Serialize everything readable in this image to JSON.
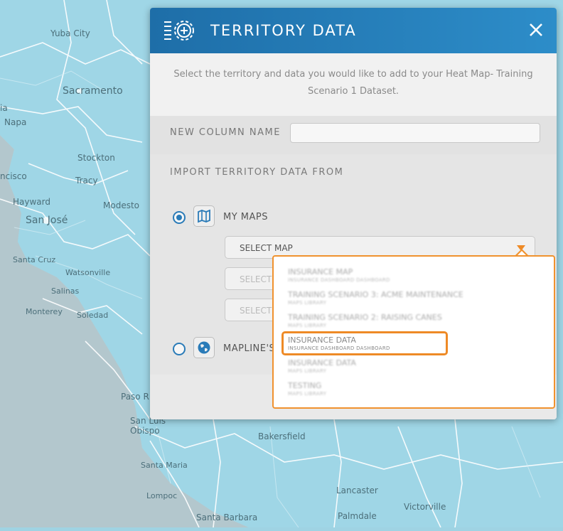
{
  "map": {
    "labels": [
      "Yuba City",
      "Sacramento",
      "Napa",
      "Stockton",
      "Tracy",
      "Hayward",
      "Modesto",
      "San José",
      "Santa Cruz",
      "Watsonville",
      "Salinas",
      "Monterey",
      "Soledad",
      "Paso R",
      "San Luis Obispo",
      "Bakersfield",
      "Santa Maria",
      "Lompoc",
      "Lancaster",
      "Victorville",
      "Palmdale",
      "Santa Barbara",
      "ncisco",
      "ia"
    ]
  },
  "modal": {
    "title": "TERRITORY DATA",
    "header_icon": "gear-list-icon",
    "close_icon": "close-icon",
    "intro": "Select the territory and data you would like to add to your Heat Map- Training Scenario 1 Dataset.",
    "new_column_label": "NEW COLUMN NAME",
    "new_column_value": "",
    "import_label": "IMPORT TERRITORY DATA FROM",
    "options": [
      {
        "label": "MY MAPS",
        "selected": true,
        "icon": "map-icon"
      },
      {
        "label": "MAPLINE'S",
        "selected": false,
        "icon": "globe-icon"
      }
    ],
    "select_map": "SELECT MAP",
    "select_2": "SELECT",
    "select_3": "SELECT"
  },
  "dropdown": {
    "items": [
      {
        "title": "INSURANCE MAP",
        "subtitle": "INSURANCE DASHBOARD DASHBOARD",
        "highlighted": false
      },
      {
        "title": "TRAINING SCENARIO 3: ACME MAINTENANCE",
        "subtitle": "MAPS LIBRARY",
        "highlighted": false
      },
      {
        "title": "TRAINING SCENARIO 2: RAISING CANES",
        "subtitle": "MAPS LIBRARY",
        "highlighted": false
      },
      {
        "title": "INSURANCE DATA",
        "subtitle": "INSURANCE DASHBOARD DASHBOARD",
        "highlighted": true
      },
      {
        "title": "INSURANCE DATA",
        "subtitle": "MAPS LIBRARY",
        "highlighted": false
      },
      {
        "title": "TESTING",
        "subtitle": "MAPS LIBRARY",
        "highlighted": false
      }
    ]
  },
  "colors": {
    "header": "#2d8dc9",
    "accent": "#f0922e",
    "radio": "#2a7bb8",
    "map_water": "#9fd3e3"
  }
}
